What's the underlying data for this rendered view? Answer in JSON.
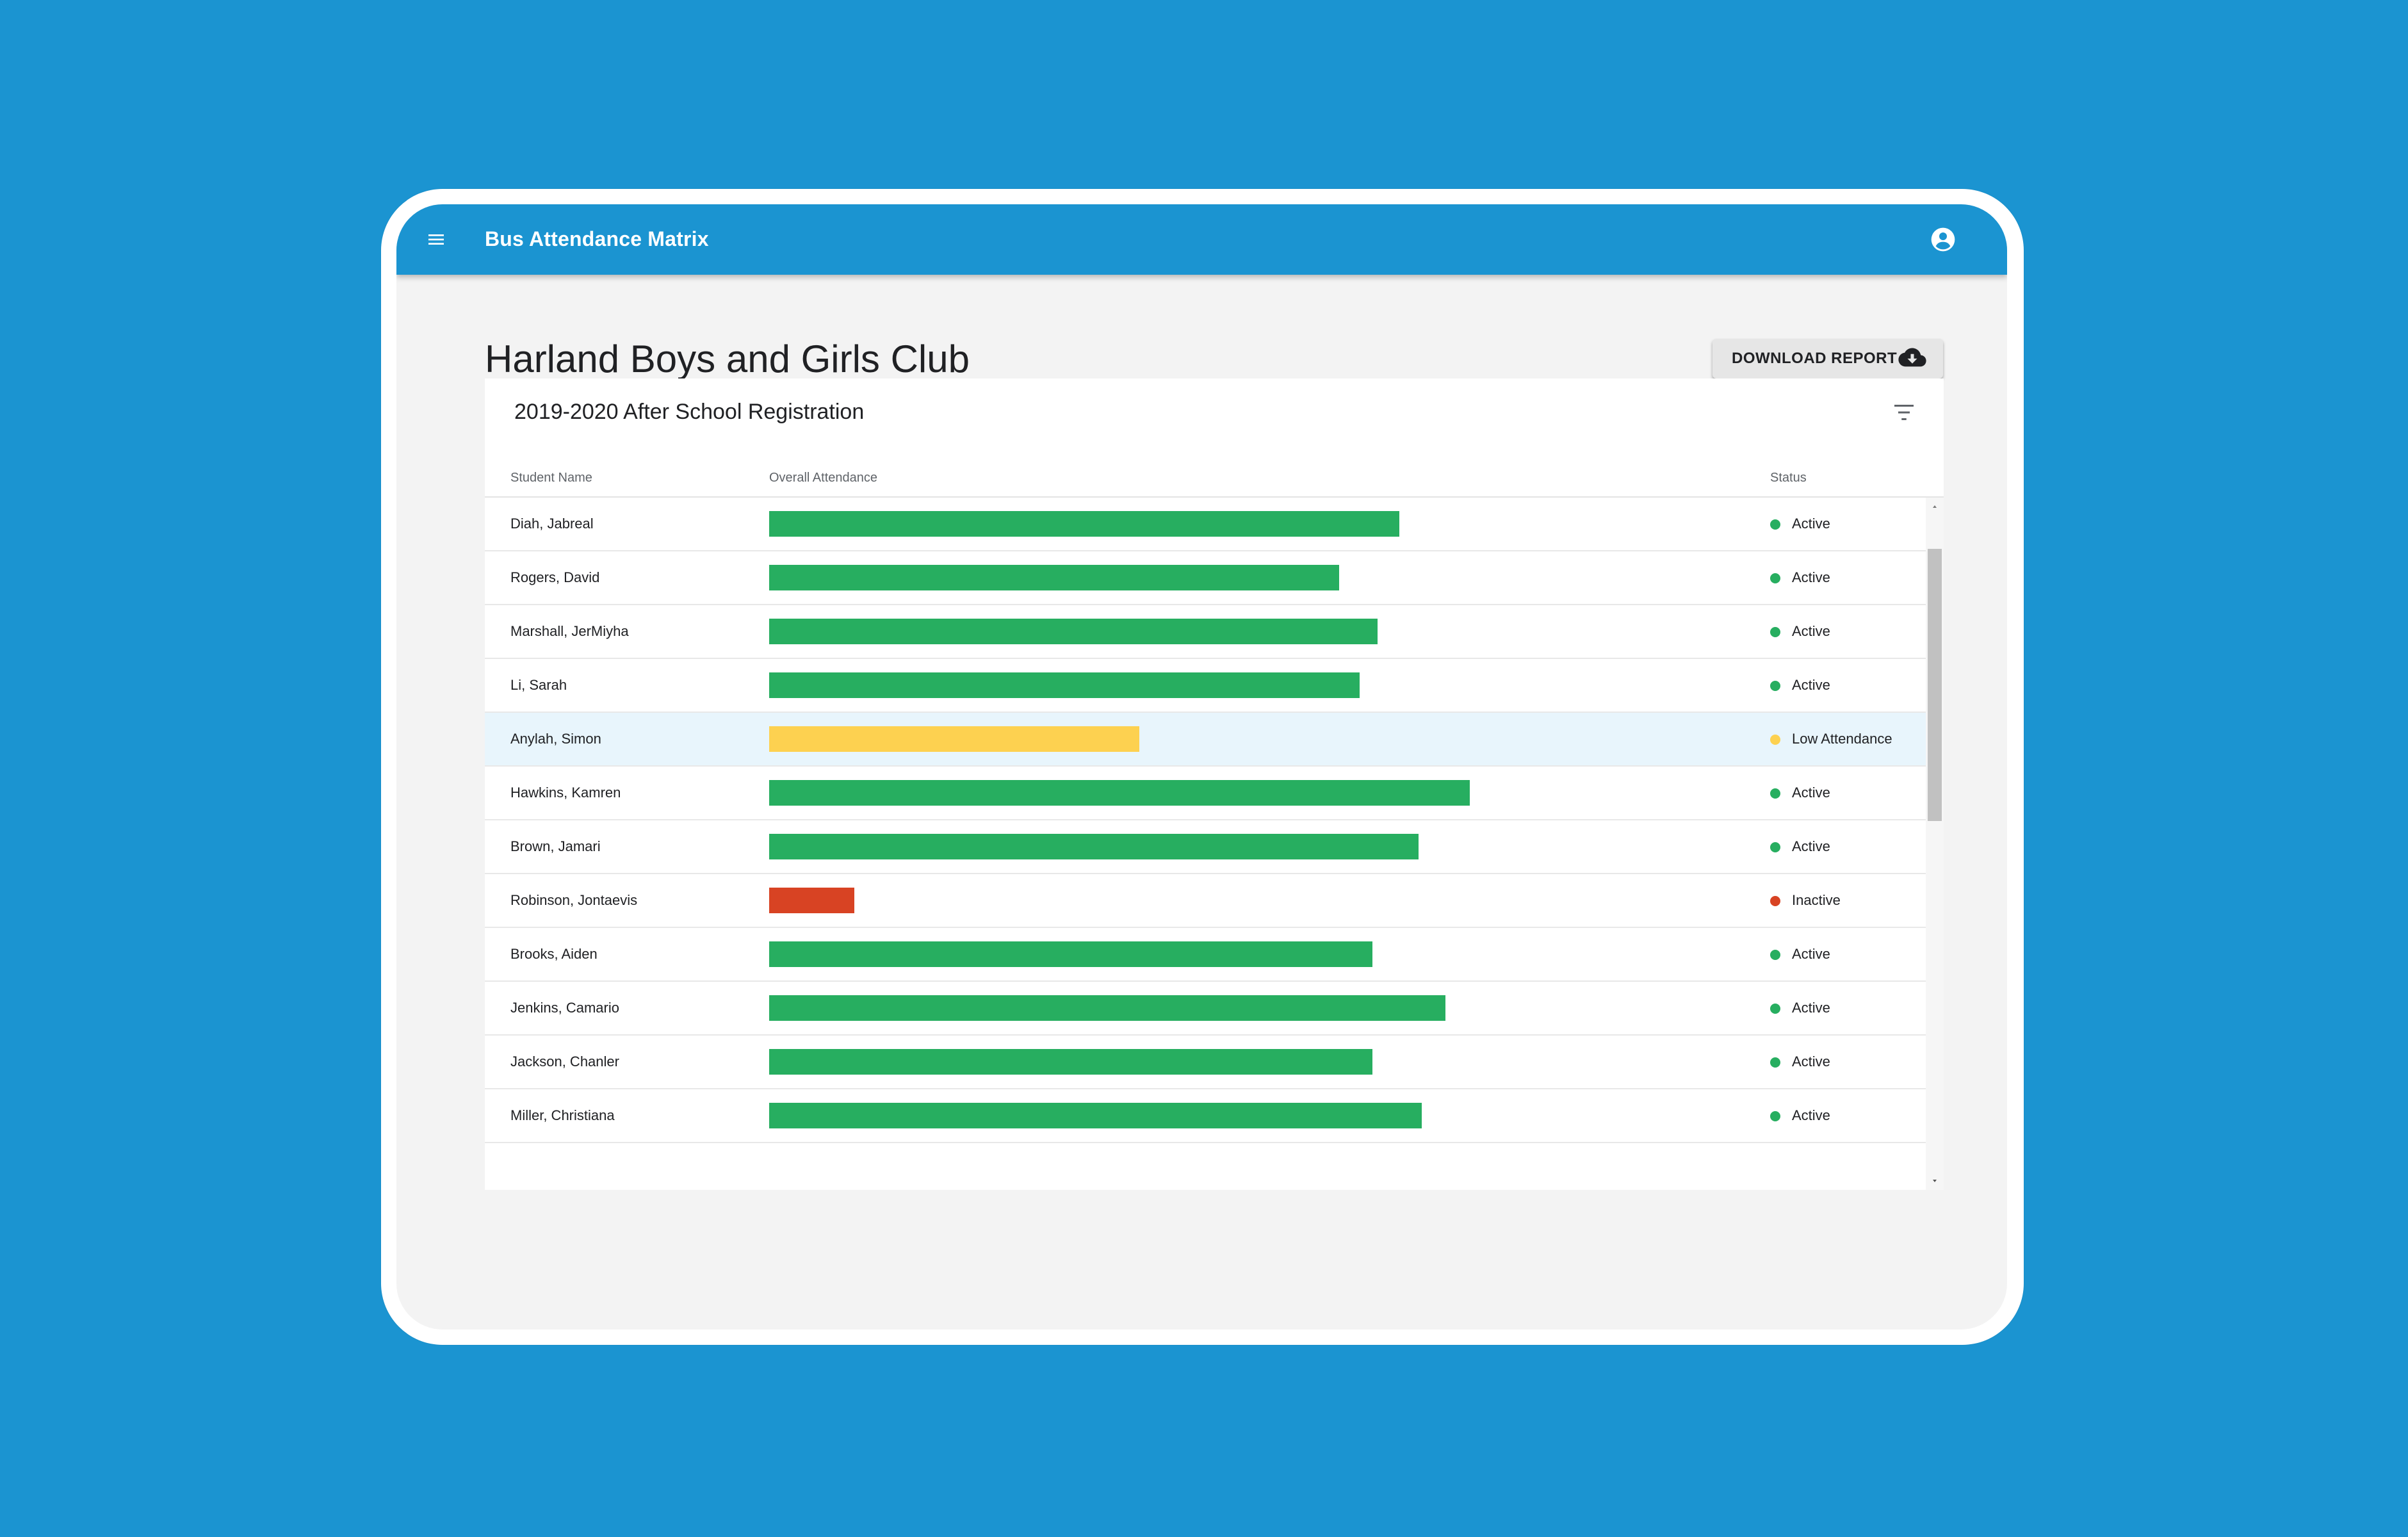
{
  "app": {
    "title": "Bus Attendance Matrix",
    "menu_icon": "menu-icon",
    "account_icon": "account-circle-icon"
  },
  "page": {
    "title": "Harland Boys and Girls Club",
    "download_label": "DOWNLOAD REPORT",
    "download_icon": "cloud-download-icon"
  },
  "table": {
    "title": "2019-2020 After School Registration",
    "filter_icon": "filter-icon",
    "headers": {
      "name": "Student Name",
      "attendance": "Overall Attendance",
      "status": "Status"
    },
    "rows": [
      {
        "name": "Diah, Jabreal",
        "attendance": 0.615,
        "status": "Active",
        "color": "#27ae60"
      },
      {
        "name": "Rogers, David",
        "attendance": 0.556,
        "status": "Active",
        "color": "#27ae60"
      },
      {
        "name": "Marshall, JerMiyha",
        "attendance": 0.594,
        "status": "Active",
        "color": "#27ae60"
      },
      {
        "name": "Li, Sarah",
        "attendance": 0.576,
        "status": "Active",
        "color": "#27ae60"
      },
      {
        "name": "Anylah, Simon",
        "attendance": 0.361,
        "status": "Low Attendance",
        "color": "#fdd150",
        "highlight": true
      },
      {
        "name": "Hawkins, Kamren",
        "attendance": 0.684,
        "status": "Active",
        "color": "#27ae60"
      },
      {
        "name": "Brown, Jamari",
        "attendance": 0.634,
        "status": "Active",
        "color": "#27ae60"
      },
      {
        "name": "Robinson, Jontaevis",
        "attendance": 0.083,
        "status": "Inactive",
        "color": "#d84323"
      },
      {
        "name": "Brooks, Aiden",
        "attendance": 0.589,
        "status": "Active",
        "color": "#27ae60"
      },
      {
        "name": "Jenkins, Camario",
        "attendance": 0.66,
        "status": "Active",
        "color": "#27ae60"
      },
      {
        "name": "Jackson, Chanler",
        "attendance": 0.589,
        "status": "Active",
        "color": "#27ae60"
      },
      {
        "name": "Miller, Christiana",
        "attendance": 0.637,
        "status": "Active",
        "color": "#27ae60"
      }
    ]
  },
  "colors": {
    "brand": "#1b94d1",
    "active": "#27ae60",
    "low": "#fdd150",
    "inactive": "#d84323"
  }
}
